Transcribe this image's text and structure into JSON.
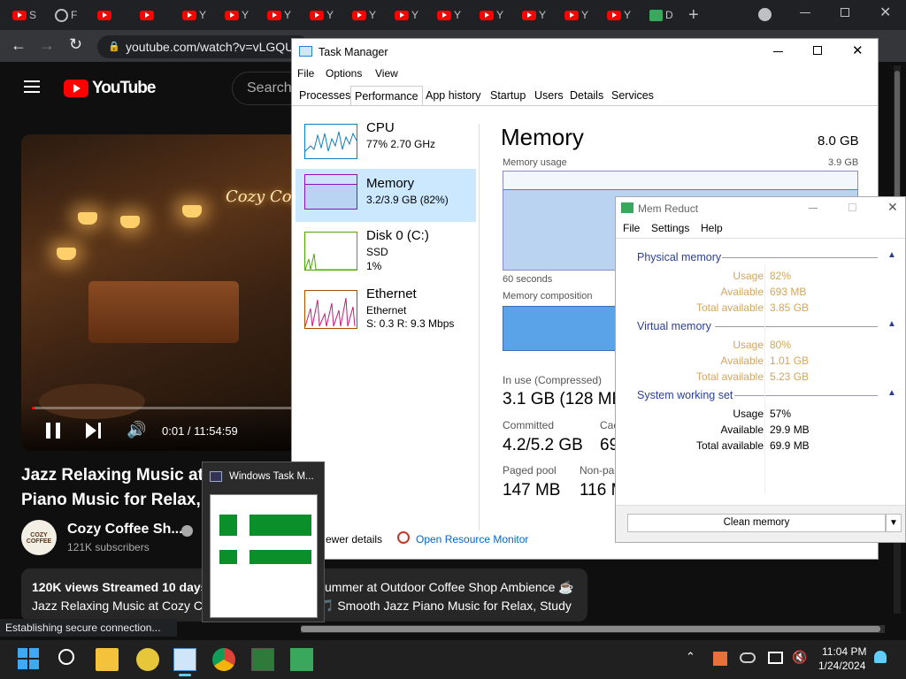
{
  "browser": {
    "tabs": [
      {
        "icon": "youtube",
        "label": "S"
      },
      {
        "icon": "globe",
        "label": "F"
      },
      {
        "icon": "youtube-audio",
        "label": ""
      },
      {
        "icon": "audio-close",
        "label": ""
      },
      {
        "icon": "youtube",
        "label": "Y"
      },
      {
        "icon": "youtube",
        "label": "Y"
      },
      {
        "icon": "youtube",
        "label": "Y"
      },
      {
        "icon": "youtube",
        "label": "Y"
      },
      {
        "icon": "youtube",
        "label": "Y"
      },
      {
        "icon": "youtube",
        "label": "Y"
      },
      {
        "icon": "youtube",
        "label": "Y"
      },
      {
        "icon": "youtube",
        "label": "Y"
      },
      {
        "icon": "youtube",
        "label": "Y"
      },
      {
        "icon": "youtube",
        "label": "Y"
      },
      {
        "icon": "youtube",
        "label": "Y"
      },
      {
        "icon": "memreduct",
        "label": "D"
      }
    ],
    "url": "youtube.com/watch?v=vLGQU",
    "status": "Establishing secure connection..."
  },
  "youtube": {
    "logo_text": "YouTube",
    "search_placeholder": "Search",
    "video_sign": "Cozy Coffe",
    "time": "0:01 / 11:54:59",
    "title_line1": "Jazz Relaxing Music at",
    "title_line2": "Piano Music for Relax,",
    "channel": "Cozy Coffee Sh...",
    "channel_avatar": "COZY COFFEE",
    "subscribers": "121K subscribers",
    "desc_stats": "120K views  Streamed 10 days",
    "desc_line": "Jazz Relaxing Music at Cozy Co",
    "desc_right1": "ummer at Outdoor Coffee Shop Ambience ☕",
    "desc_right2": "🎵 Smooth Jazz Piano Music for Relax, Study"
  },
  "task_manager": {
    "title": "Task Manager",
    "menu": [
      "File",
      "Options",
      "View"
    ],
    "tabs": [
      "Processes",
      "Performance",
      "App history",
      "Startup",
      "Users",
      "Details",
      "Services"
    ],
    "sidebar": [
      {
        "name": "CPU",
        "line1": "77%  2.70 GHz",
        "line2": "",
        "color": "#117dbb"
      },
      {
        "name": "Memory",
        "line1": "3.2/3.9 GB (82%)",
        "line2": "",
        "color": "#8b12ae"
      },
      {
        "name": "Disk 0 (C:)",
        "line1": "SSD",
        "line2": "1%",
        "color": "#4da60c"
      },
      {
        "name": "Ethernet",
        "line1": "Ethernet",
        "line2": "S: 0.3  R: 9.3 Mbps",
        "color": "#a74f01"
      }
    ],
    "main_title": "Memory",
    "total": "8.0 GB",
    "usage_label": "Memory usage",
    "usage_max": "3.9 GB",
    "seconds": "60 seconds",
    "composition": "Memory composition",
    "stats": [
      {
        "label": "In use (Compressed)",
        "value": "3.1 GB (128 MB"
      },
      {
        "label": "Committed",
        "value": "4.2/5.2 GB"
      },
      {
        "label": "Cac",
        "value": "69"
      },
      {
        "label": "Paged pool",
        "value": "147 MB"
      },
      {
        "label": "Non-pa",
        "value": "116 M"
      }
    ],
    "fewer_details": "ewer details",
    "resource_monitor": "Open Resource Monitor"
  },
  "mem_reduct": {
    "title": "Mem Reduct",
    "menu": [
      "File",
      "Settings",
      "Help"
    ],
    "sections": [
      {
        "title": "Physical memory",
        "rows": [
          [
            "Usage",
            "82%"
          ],
          [
            "Available",
            "693 MB"
          ],
          [
            "Total available",
            "3.85 GB"
          ]
        ],
        "color": "#d4a55a"
      },
      {
        "title": "Virtual memory",
        "rows": [
          [
            "Usage",
            "80%"
          ],
          [
            "Available",
            "1.01 GB"
          ],
          [
            "Total available",
            "5.23 GB"
          ]
        ],
        "color": "#d4a55a"
      },
      {
        "title": "System working set",
        "rows": [
          [
            "Usage",
            "57%"
          ],
          [
            "Available",
            "29.9 MB"
          ],
          [
            "Total available",
            "69.9 MB"
          ]
        ],
        "color": "#000000"
      }
    ],
    "clean_button": "Clean memory"
  },
  "preview": {
    "title": "Windows Task M..."
  },
  "taskbar": {
    "time": "11:04 PM",
    "date": "1/24/2024"
  }
}
